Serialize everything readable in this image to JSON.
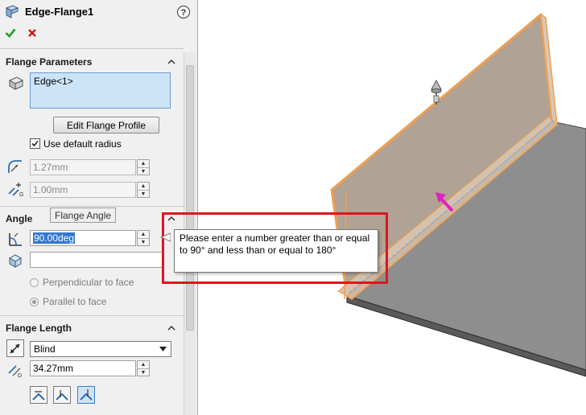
{
  "header": {
    "title": "Edge-Flange1",
    "help_icon": "question-circle-icon"
  },
  "actions": {
    "ok_icon": "check-icon",
    "cancel_icon": "x-icon",
    "ok_color": "#2a9a2a",
    "cancel_color": "#d01818"
  },
  "flange_parameters": {
    "title": "Flange Parameters",
    "edge_selection": "Edge<1>",
    "edit_profile_label": "Edit Flange Profile",
    "use_default_radius_label": "Use default radius",
    "use_default_radius_checked": true,
    "radius_value": "1.27mm",
    "gap_value": "1.00mm"
  },
  "angle": {
    "title": "Angle",
    "hover_tooltip": "Flange Angle",
    "angle_value": "90.00deg",
    "reference_value": "",
    "perpendicular_label": "Perpendicular to face",
    "parallel_label": "Parallel to face"
  },
  "flange_length": {
    "title": "Flange Length",
    "end_condition": "Blind",
    "length_value": "34.27mm"
  },
  "error_tooltip": {
    "text": "Please enter a number greater than or equal to 90° and less than or equal to 180°"
  },
  "colors": {
    "highlight_edge": "#f0a050",
    "flange_face": "#b0a294",
    "base_face": "#8e8e8e",
    "direction_arrow": "#e020c0",
    "alert_frame": "#e0141e",
    "selection_fill": "#cce4f7"
  }
}
